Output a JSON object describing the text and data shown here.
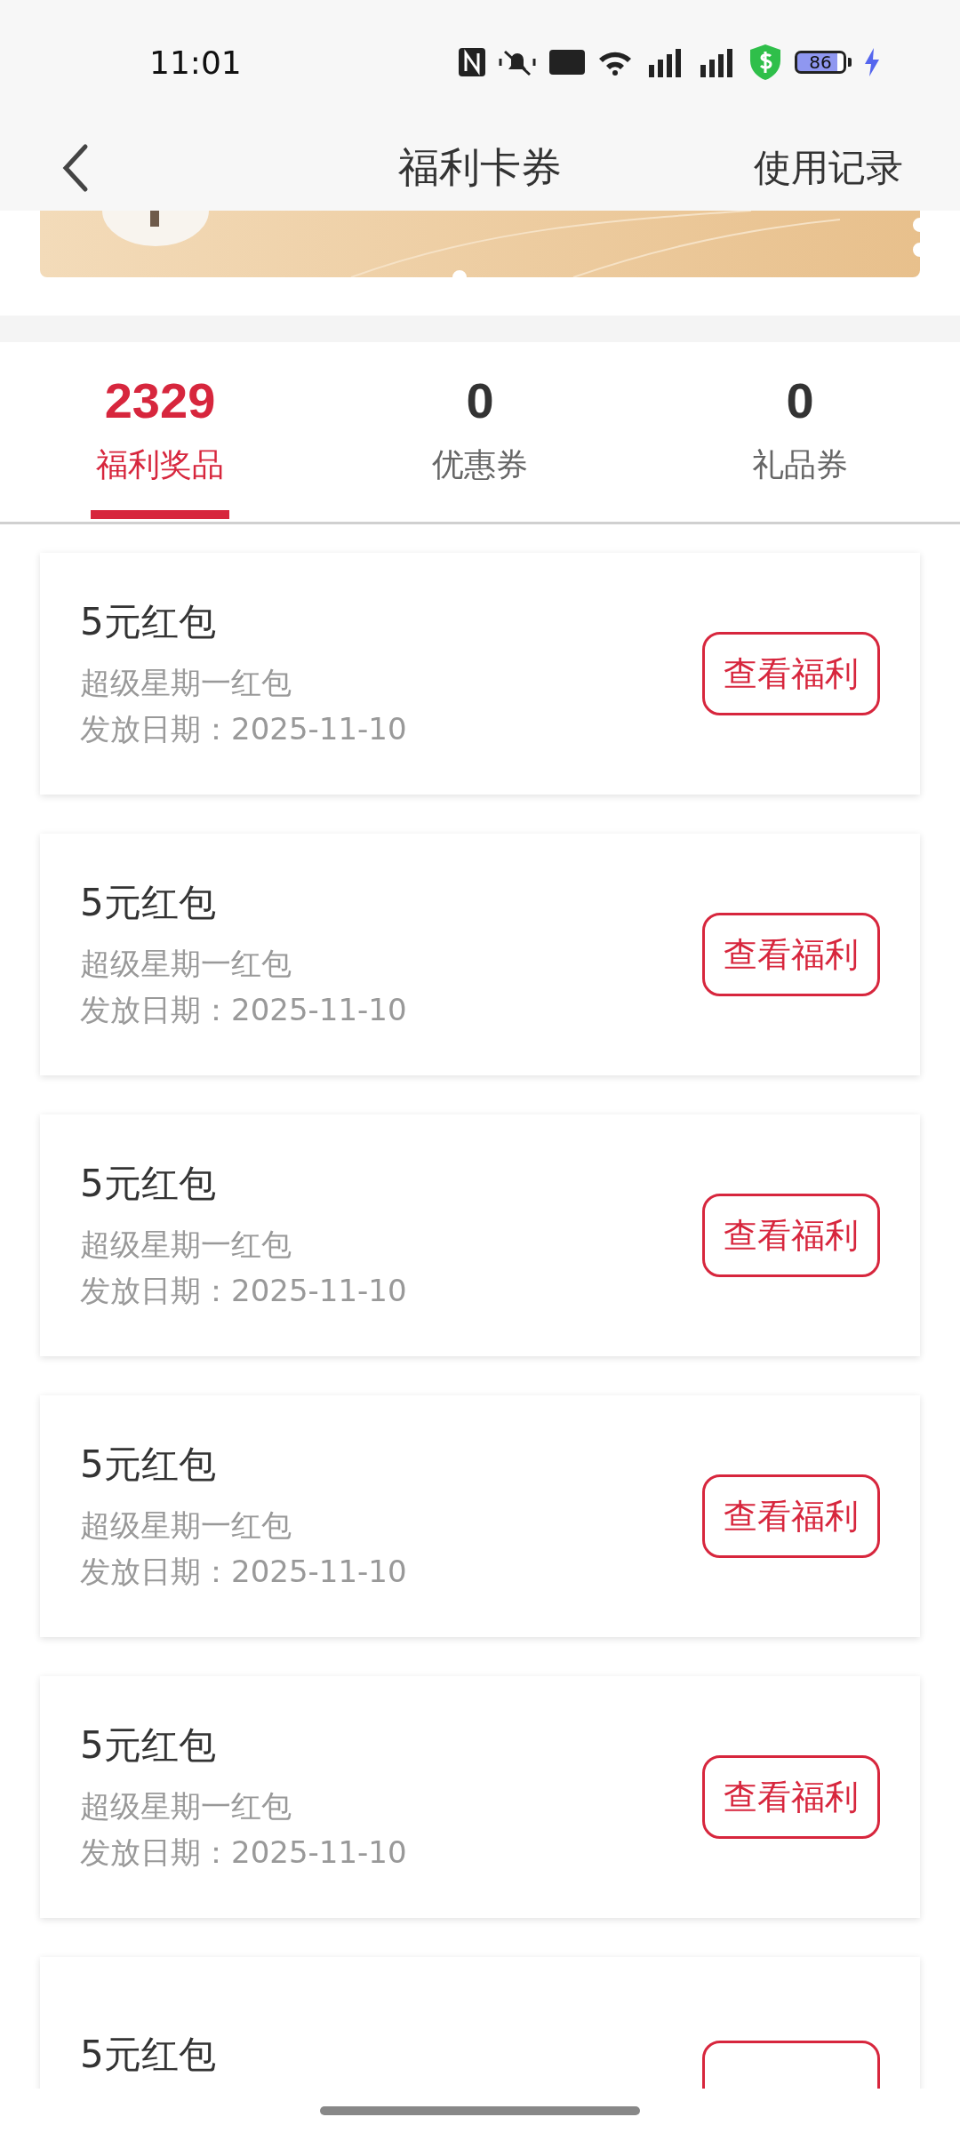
{
  "status_bar": {
    "time": "11:01",
    "battery": "86"
  },
  "header": {
    "title": "福利卡券",
    "action": "使用记录"
  },
  "banner": {
    "kind": "coupon"
  },
  "tabs": [
    {
      "count": "2329",
      "label": "福利奖品",
      "selected": true
    },
    {
      "count": "0",
      "label": "优惠券",
      "selected": false
    },
    {
      "count": "0",
      "label": "礼品券",
      "selected": false
    }
  ],
  "cards": [
    {
      "title": "5元红包",
      "subtitle": "超级星期一红包",
      "date": "发放日期：2025-11-10",
      "button": "查看福利"
    },
    {
      "title": "5元红包",
      "subtitle": "超级星期一红包",
      "date": "发放日期：2025-11-10",
      "button": "查看福利"
    },
    {
      "title": "5元红包",
      "subtitle": "超级星期一红包",
      "date": "发放日期：2025-11-10",
      "button": "查看福利"
    },
    {
      "title": "5元红包",
      "subtitle": "超级星期一红包",
      "date": "发放日期：2025-11-10",
      "button": "查看福利"
    },
    {
      "title": "5元红包",
      "subtitle": "超级星期一红包",
      "date": "发放日期：2025-11-10",
      "button": "查看福利"
    },
    {
      "title": "5元红包"
    }
  ]
}
